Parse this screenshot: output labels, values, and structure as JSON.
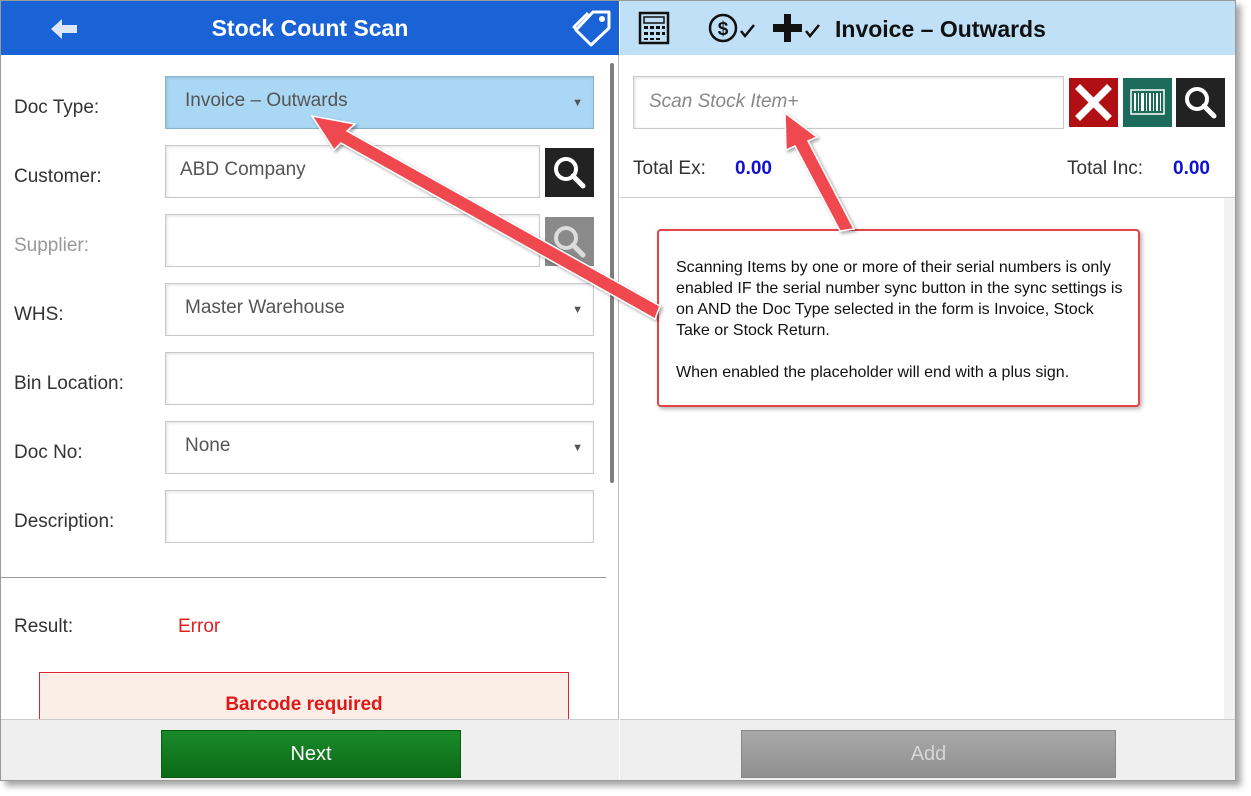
{
  "left_panel": {
    "title": "Stock Count Scan",
    "form": {
      "doc_type": {
        "label": "Doc Type:",
        "value": "Invoice – Outwards"
      },
      "customer": {
        "label": "Customer:",
        "value": "ABD  Company"
      },
      "supplier": {
        "label": "Supplier:",
        "value": ""
      },
      "whs": {
        "label": "WHS:",
        "value": "Master Warehouse"
      },
      "bin_location": {
        "label": "Bin Location:",
        "value": ""
      },
      "doc_no": {
        "label": "Doc No:",
        "value": "None"
      },
      "description": {
        "label": "Description:",
        "value": ""
      }
    },
    "result": {
      "label": "Result:",
      "value": "Error"
    },
    "error_message": "Barcode required",
    "next_label": "Next"
  },
  "right_panel": {
    "title": "Invoice – Outwards",
    "scan_placeholder": "Scan Stock Item+",
    "totals": {
      "ex_label": "Total Ex:",
      "ex_value": "0.00",
      "inc_label": "Total Inc:",
      "inc_value": "0.00"
    },
    "add_label": "Add"
  },
  "callout": {
    "paragraph_1": "Scanning Items by one or more of their serial numbers is only enabled IF the serial number sync button in the sync settings is on AND the Doc Type selected in the form is Invoice, Stock Take or Stock Return.",
    "paragraph_2": "When enabled the placeholder will end with a plus sign."
  },
  "colors": {
    "left_header": "#1a63d6",
    "right_header": "#bfe0f6",
    "doc_type_highlight": "#a9d7f4",
    "error_text": "#e01818",
    "totals_value": "#1010d0",
    "next_button": "#0b6a17",
    "clear_button": "#b01014",
    "barcode_button": "#1d6b5a",
    "annotation_arrow": "#e2444a"
  },
  "icons": {
    "back": "arrow-left-icon",
    "tag": "tags-icon",
    "calculator": "calculator-icon",
    "price_check": "dollar-check-icon",
    "add_check": "plus-check-icon",
    "clear": "close-icon",
    "barcode": "barcode-icon",
    "search": "search-icon"
  }
}
